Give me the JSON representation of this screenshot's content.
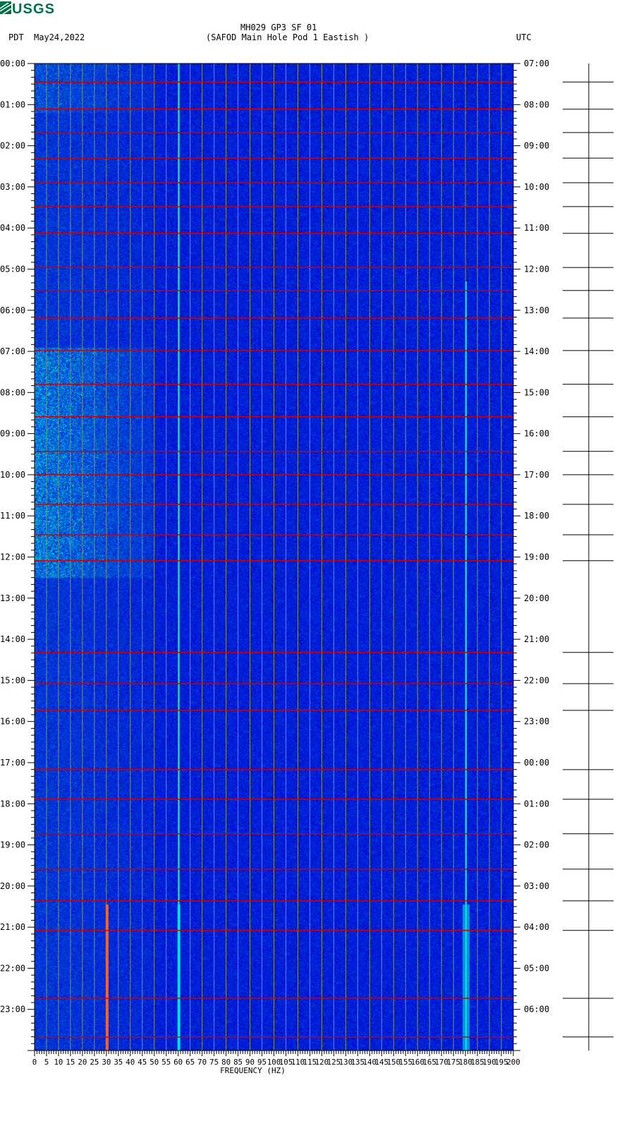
{
  "header": {
    "logo_text": "USGS",
    "title_line1": "MH029 GP3 SF 01",
    "title_line2": "(SAFOD Main Hole Pod 1 Eastish )",
    "left_tz": "PDT",
    "date": "May24,2022",
    "right_tz": "UTC"
  },
  "colors": {
    "background": "#0000cc",
    "event": "#cc0000",
    "grid": "#8c8c5a",
    "hum": "#00e0e0"
  },
  "chart_data": {
    "type": "heatmap",
    "title": "MH029 GP3 SF 01 (SAFOD Main Hole Pod 1 Eastish )",
    "xlabel": "FREQUENCY (HZ)",
    "xlim": [
      0,
      200
    ],
    "ylim_hours": [
      0,
      24
    ],
    "x_ticks": [
      "0",
      "5",
      "10",
      "15",
      "20",
      "25",
      "30",
      "35",
      "40",
      "45",
      "50",
      "55",
      "60",
      "65",
      "70",
      "75",
      "80",
      "85",
      "90",
      "95",
      "100",
      "105",
      "110",
      "115",
      "120",
      "125",
      "130",
      "135",
      "140",
      "145",
      "150",
      "155",
      "160",
      "165",
      "170",
      "175",
      "180",
      "185",
      "190",
      "195",
      "200"
    ],
    "left_ticks_pdt": [
      "00:00",
      "01:00",
      "02:00",
      "03:00",
      "04:00",
      "05:00",
      "06:00",
      "07:00",
      "08:00",
      "09:00",
      "10:00",
      "11:00",
      "12:00",
      "13:00",
      "14:00",
      "15:00",
      "16:00",
      "17:00",
      "18:00",
      "19:00",
      "20:00",
      "21:00",
      "22:00",
      "23:00"
    ],
    "right_ticks_utc": [
      "07:00",
      "08:00",
      "09:00",
      "10:00",
      "11:00",
      "12:00",
      "13:00",
      "14:00",
      "15:00",
      "16:00",
      "17:00",
      "18:00",
      "19:00",
      "20:00",
      "21:00",
      "22:00",
      "23:00",
      "00:00",
      "01:00",
      "02:00",
      "03:00",
      "04:00",
      "05:00",
      "06:00"
    ],
    "event_hours_pdt": [
      0.45,
      1.11,
      1.68,
      2.3,
      2.9,
      3.48,
      4.13,
      4.96,
      5.52,
      6.19,
      6.98,
      7.8,
      8.59,
      9.43,
      10.0,
      10.72,
      11.46,
      12.09,
      14.32,
      15.08,
      15.73,
      17.17,
      17.89,
      18.73,
      19.59,
      20.36,
      21.08,
      22.73,
      23.67
    ],
    "persistent_lines_hz": [
      60,
      180
    ],
    "late_lines": [
      {
        "hz": 30,
        "start_hour": 20.45
      },
      {
        "hz": 60,
        "start_hour": 20.45
      },
      {
        "hz": 180,
        "start_hour": 20.45
      }
    ],
    "low_freq_energy_hz": [
      5,
      50
    ]
  }
}
